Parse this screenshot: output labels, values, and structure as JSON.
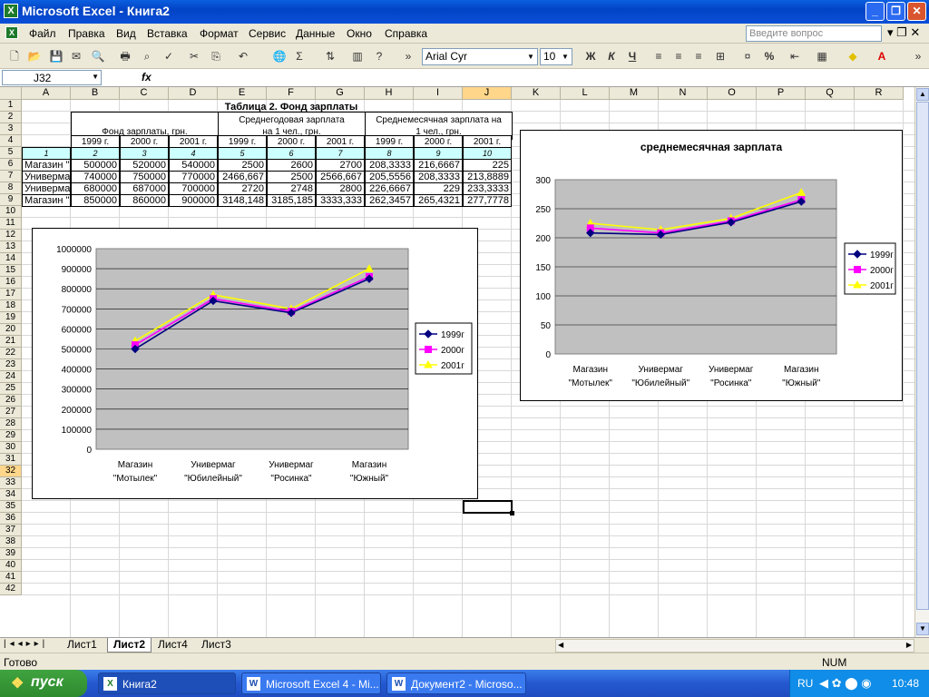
{
  "window": {
    "title": "Microsoft Excel - Книга2"
  },
  "menu": {
    "items": [
      "Файл",
      "Правка",
      "Вид",
      "Вставка",
      "Формат",
      "Сервис",
      "Данные",
      "Окно",
      "Справка"
    ],
    "help_placeholder": "Введите вопрос"
  },
  "toolbar": {
    "font": "Arial Cyr",
    "size": "10",
    "bold": "Ж",
    "italic": "К",
    "underline": "Ч",
    "percent": "%",
    "sum": "Σ"
  },
  "formula": {
    "cell_ref": "J32",
    "fx": "fx"
  },
  "columns": [
    "A",
    "B",
    "C",
    "D",
    "E",
    "F",
    "G",
    "H",
    "I",
    "J",
    "K",
    "L",
    "M",
    "N",
    "O",
    "P",
    "Q",
    "R"
  ],
  "rows": [
    "1",
    "2",
    "3",
    "4",
    "5",
    "6",
    "7",
    "8",
    "9",
    "10",
    "11",
    "12",
    "13",
    "14",
    "15",
    "16",
    "17",
    "18",
    "19",
    "20",
    "21",
    "22",
    "23",
    "24",
    "25",
    "26",
    "27",
    "28",
    "29",
    "30",
    "31",
    "32",
    "33",
    "34",
    "35",
    "36",
    "37",
    "38",
    "39",
    "40",
    "41",
    "42"
  ],
  "table": {
    "title": "Таблица 2. Фонд зарплаты",
    "h_fund": "Фонд зарплаты, грн.",
    "h_avg_year_1": "Среднегодовая зарплата",
    "h_avg_year_2": "на 1 чел., грн.",
    "h_avg_month_1": "Среднемесячная зарплата на",
    "h_avg_month_2": "1 чел., грн.",
    "years": [
      "1999 г.",
      "2000 г.",
      "2001 г.",
      "1999 г.",
      "2000 г.",
      "2001 г.",
      "1999 г.",
      "2000 г.",
      "2001 г."
    ],
    "index": [
      "1",
      "2",
      "3",
      "4",
      "5",
      "6",
      "7",
      "8",
      "9",
      "10"
    ],
    "data": [
      [
        "Магазин \"М",
        "500000",
        "520000",
        "540000",
        "2500",
        "2600",
        "2700",
        "208,3333",
        "216,6667",
        "225"
      ],
      [
        "Универма",
        "740000",
        "750000",
        "770000",
        "2466,667",
        "2500",
        "2566,667",
        "205,5556",
        "208,3333",
        "213,8889"
      ],
      [
        "Универма",
        "680000",
        "687000",
        "700000",
        "2720",
        "2748",
        "2800",
        "226,6667",
        "229",
        "233,3333"
      ],
      [
        "Магазин \"",
        "850000",
        "860000",
        "900000",
        "3148,148",
        "3185,185",
        "3333,333",
        "262,3457",
        "265,4321",
        "277,7778"
      ]
    ]
  },
  "chart_data": [
    {
      "type": "line",
      "title": "",
      "categories": [
        [
          "Магазин",
          "\"Мотылек\""
        ],
        [
          "Универмаг",
          "\"Юбилейный\""
        ],
        [
          "Универмаг",
          "\"Росинка\""
        ],
        [
          "Магазин",
          "\"Южный\""
        ]
      ],
      "series": [
        {
          "name": "1999г",
          "values": [
            500000,
            740000,
            680000,
            850000
          ],
          "color": "#000080",
          "marker": "diamond"
        },
        {
          "name": "2000г",
          "values": [
            520000,
            750000,
            687000,
            860000
          ],
          "color": "#ff00ff",
          "marker": "square"
        },
        {
          "name": "2001г",
          "values": [
            540000,
            770000,
            700000,
            900000
          ],
          "color": "#ffff00",
          "marker": "triangle"
        }
      ],
      "ylim": [
        0,
        1000000
      ],
      "ytick": 100000,
      "yticklabels": [
        "0",
        "100000",
        "200000",
        "300000",
        "400000",
        "500000",
        "600000",
        "700000",
        "800000",
        "900000",
        "1000000"
      ],
      "plot_bg": "#c0c0c0",
      "grid": true,
      "legend": "right"
    },
    {
      "type": "line",
      "title": "среднемесячная зарплата",
      "categories": [
        [
          "Магазин",
          "\"Мотылек\""
        ],
        [
          "Универмаг",
          "\"Юбилейный\""
        ],
        [
          "Универмаг",
          "\"Росинка\""
        ],
        [
          "Магазин",
          "\"Южный\""
        ]
      ],
      "series": [
        {
          "name": "1999г",
          "values": [
            208.3333,
            205.5556,
            226.6667,
            262.3457
          ],
          "color": "#000080",
          "marker": "diamond"
        },
        {
          "name": "2000г",
          "values": [
            216.6667,
            208.3333,
            229,
            265.4321
          ],
          "color": "#ff00ff",
          "marker": "square"
        },
        {
          "name": "2001г",
          "values": [
            225,
            213.8889,
            233.3333,
            277.7778
          ],
          "color": "#ffff00",
          "marker": "triangle"
        }
      ],
      "ylim": [
        0,
        300
      ],
      "ytick": 50,
      "yticklabels": [
        "0",
        "50",
        "100",
        "150",
        "200",
        "250",
        "300"
      ],
      "plot_bg": "#c0c0c0",
      "grid": true,
      "legend": "right"
    }
  ],
  "sheets": {
    "tabs": [
      "Лист1",
      "Лист2",
      "Лист4",
      "Лист3"
    ],
    "active": "Лист2"
  },
  "status": {
    "ready": "Готово",
    "num": "NUM"
  },
  "taskbar": {
    "start": "пуск",
    "tasks": [
      "Книга2",
      "Microsoft Excel 4 - Mi...",
      "Документ2 - Microso..."
    ],
    "lang": "RU",
    "time": "10:48"
  }
}
